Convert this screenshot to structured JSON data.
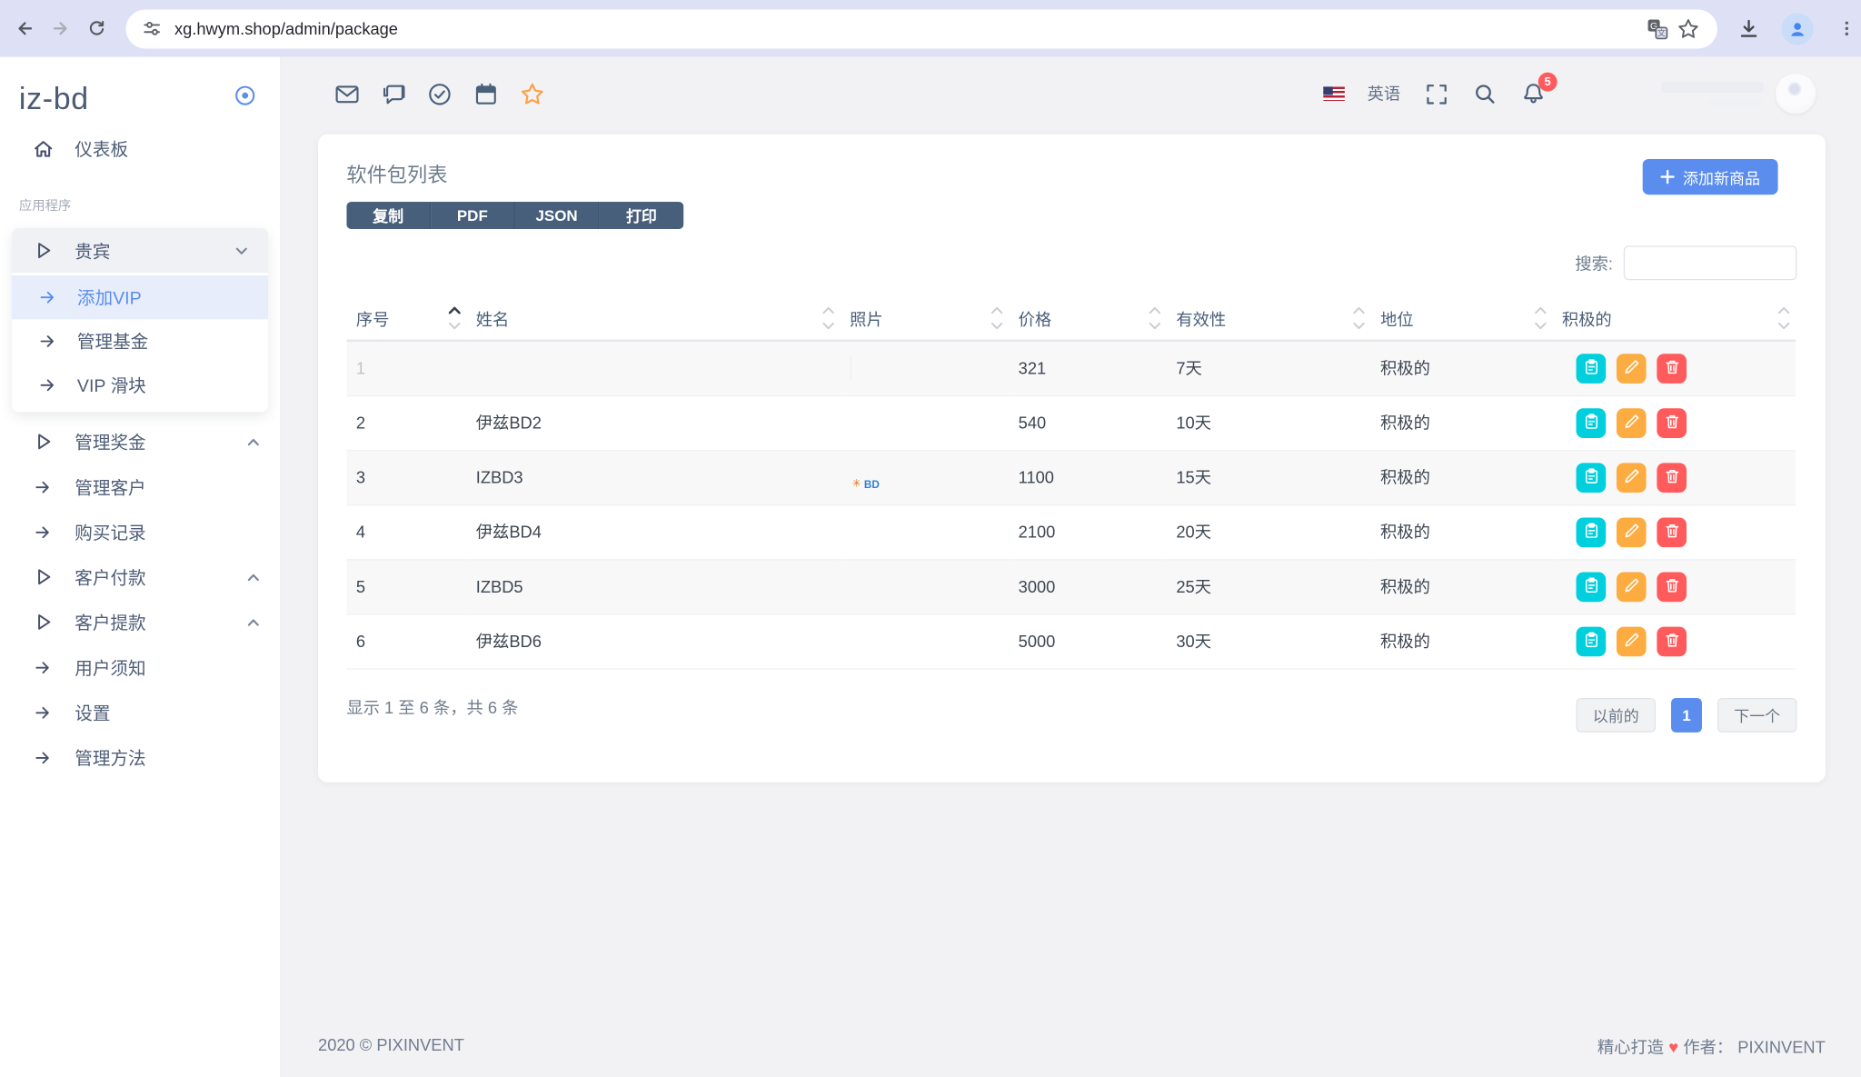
{
  "browser": {
    "url": "xg.hwym.shop/admin/package"
  },
  "sidebar": {
    "brand": "iz-bd",
    "items": [
      {
        "type": "item",
        "name": "dashboard",
        "icon": "home",
        "label": "仪表板"
      },
      {
        "type": "section",
        "label": "应用程序"
      },
      {
        "type": "group",
        "name": "vip",
        "icon": "play",
        "label": "贵宾",
        "chevron": "down",
        "expanded": true,
        "children": [
          {
            "name": "add-vip",
            "label": "添加VIP",
            "active": true
          },
          {
            "name": "manage-funds",
            "label": "管理基金"
          },
          {
            "name": "vip-slider",
            "label": "VIP 滑块"
          }
        ]
      },
      {
        "type": "item",
        "name": "manage-bonus",
        "icon": "play",
        "label": "管理奖金",
        "chevron": "up"
      },
      {
        "type": "item",
        "name": "manage-customers",
        "icon": "arrow",
        "label": "管理客户"
      },
      {
        "type": "item",
        "name": "purchase-records",
        "icon": "arrow",
        "label": "购买记录"
      },
      {
        "type": "item",
        "name": "customer-payments",
        "icon": "play",
        "label": "客户付款",
        "chevron": "up"
      },
      {
        "type": "item",
        "name": "customer-withdrawals",
        "icon": "play",
        "label": "客户提款",
        "chevron": "up"
      },
      {
        "type": "item",
        "name": "user-notice",
        "icon": "arrow",
        "label": "用户须知"
      },
      {
        "type": "item",
        "name": "settings",
        "icon": "arrow",
        "label": "设置"
      },
      {
        "type": "item",
        "name": "manage-methods",
        "icon": "arrow",
        "label": "管理方法"
      }
    ]
  },
  "topbar": {
    "left_icons": [
      "mail-icon",
      "chat-icon",
      "check-circle-icon",
      "calendar-icon",
      "star-icon"
    ],
    "language": "英语",
    "notification_count": "5"
  },
  "package_card": {
    "title": "软件包列表",
    "export_buttons": [
      "复制",
      "PDF",
      "JSON",
      "打印"
    ],
    "export_names": [
      "copy",
      "pdf",
      "json",
      "print"
    ],
    "add_button_label": "添加新商品",
    "search_label": "搜索:",
    "search_value": "",
    "table": {
      "columns": [
        {
          "label": "序号",
          "sort": "asc"
        },
        {
          "label": "姓名"
        },
        {
          "label": "照片"
        },
        {
          "label": "价格"
        },
        {
          "label": "有效性"
        },
        {
          "label": "地位"
        },
        {
          "label": "积极的"
        }
      ],
      "rows": [
        {
          "no": "1",
          "name": "",
          "photo": "ghost",
          "price": "321",
          "validity": "7天",
          "status": "积极的",
          "ghost": true
        },
        {
          "no": "2",
          "name": "伊兹BD2",
          "photo": "building-sky",
          "price": "540",
          "validity": "10天",
          "status": "积极的"
        },
        {
          "no": "3",
          "name": "IZBD3",
          "photo": "bd-logo",
          "price": "1100",
          "validity": "15天",
          "status": "积极的"
        },
        {
          "no": "4",
          "name": "伊兹BD4",
          "photo": "building-sky2",
          "price": "2100",
          "validity": "20天",
          "status": "积极的"
        },
        {
          "no": "5",
          "name": "IZBD5",
          "photo": "starburst-dark",
          "price": "3000",
          "validity": "25天",
          "status": "积极的"
        },
        {
          "no": "6",
          "name": "伊兹BD6",
          "photo": "grey-collage",
          "price": "5000",
          "validity": "30天",
          "status": "积极的"
        }
      ]
    },
    "summary": "显示 1 至 6 条，共 6 条",
    "pagination": {
      "previous": "以前的",
      "current": "1",
      "next": "下一个"
    }
  },
  "page_footer": {
    "copyright": "2020 © PIXINVENT",
    "made_text": "精心打造",
    "heart": "♥",
    "author_text": "作者： PIXINVENT"
  },
  "colors": {
    "primary": "#5a8dee",
    "dark_slate": "#475f7b",
    "teal": "#00cfdd",
    "orange": "#fdac41",
    "red": "#ff5b5c"
  }
}
